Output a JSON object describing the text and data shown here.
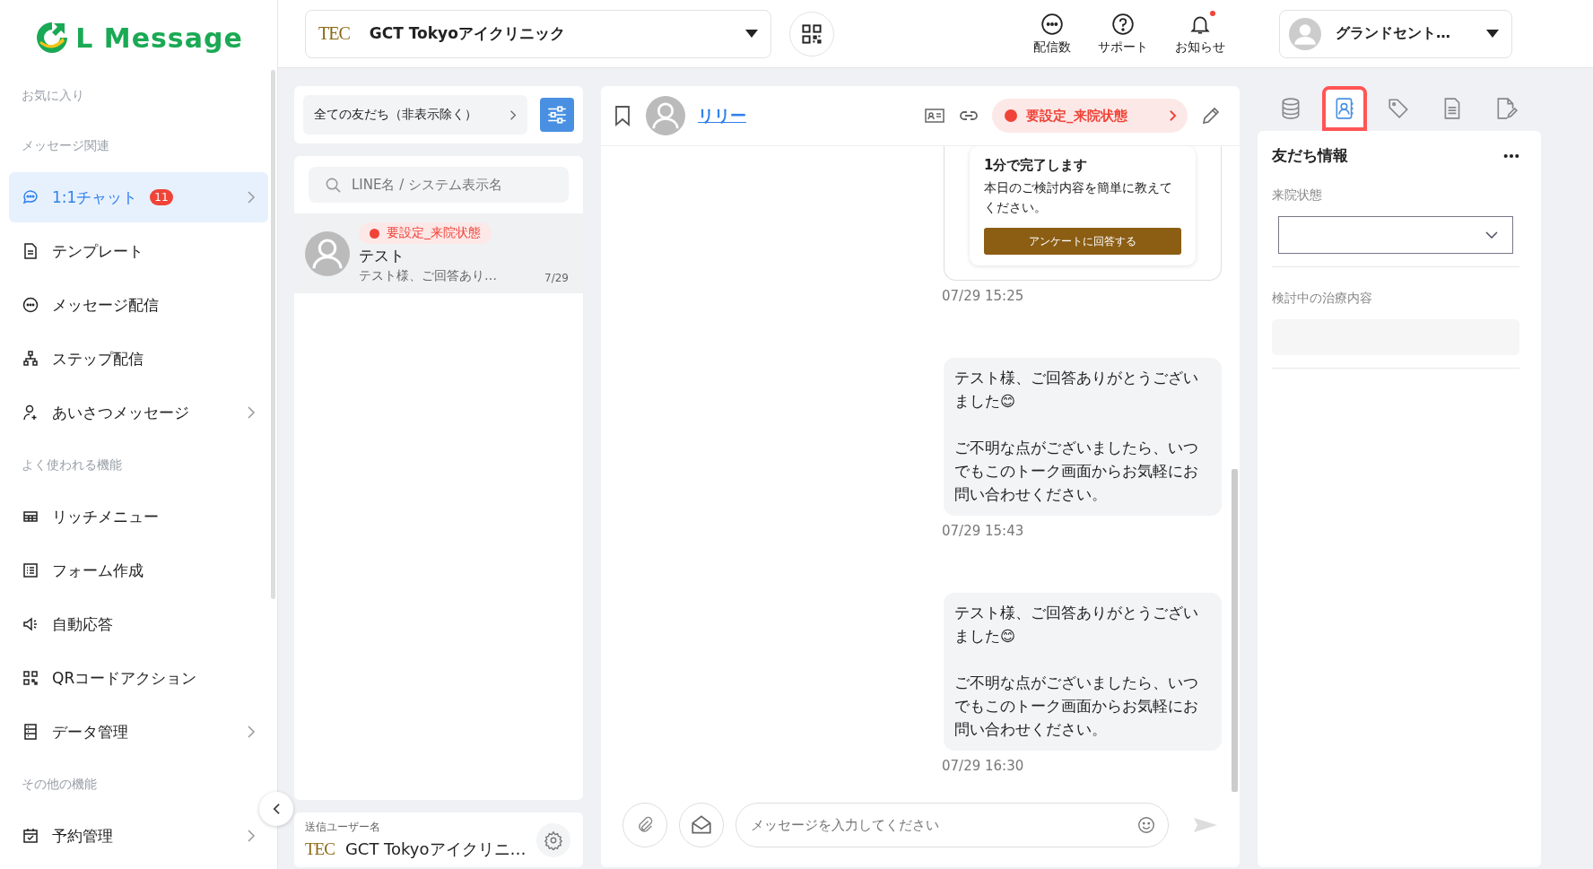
{
  "logo": {
    "text": "L Message"
  },
  "sidebar": {
    "sections": [
      {
        "label": "お気に入り"
      },
      {
        "label": "メッセージ関連",
        "items": [
          {
            "label": "1:1チャット",
            "badge": "11",
            "has_submenu": true,
            "selected": true
          },
          {
            "label": "テンプレート",
            "has_submenu": false,
            "selected": false
          },
          {
            "label": "メッセージ配信",
            "has_submenu": false,
            "selected": false
          },
          {
            "label": "ステップ配信",
            "has_submenu": false,
            "selected": false
          },
          {
            "label": "あいさつメッセージ",
            "has_submenu": true,
            "selected": false
          }
        ]
      },
      {
        "label": "よく使われる機能",
        "items": [
          {
            "label": "リッチメニュー",
            "has_submenu": false,
            "selected": false
          },
          {
            "label": "フォーム作成",
            "has_submenu": false,
            "selected": false
          },
          {
            "label": "自動応答",
            "has_submenu": false,
            "selected": false
          },
          {
            "label": "QRコードアクション",
            "has_submenu": false,
            "selected": false
          },
          {
            "label": "データ管理",
            "has_submenu": true,
            "selected": false
          }
        ]
      },
      {
        "label": "その他の機能",
        "items": [
          {
            "label": "予約管理",
            "has_submenu": true,
            "selected": false
          }
        ]
      }
    ]
  },
  "account": {
    "logo": "TEC",
    "name": "GCT Tokyoアイクリニック"
  },
  "header_actions": [
    {
      "label": "配信数",
      "unread": false
    },
    {
      "label": "サポート",
      "unread": false
    },
    {
      "label": "お知らせ",
      "unread": true
    }
  ],
  "user": {
    "name": "グランドセント…"
  },
  "friend_list": {
    "filter": "全ての友だち（非表示除く）",
    "search_placeholder": "LINE名 / システム表示名",
    "friends": [
      {
        "tag": "要設定_来院状態",
        "name": "テスト",
        "preview": "テスト様、ご回答あり…",
        "date": "7/29",
        "selected": true
      }
    ],
    "sender": {
      "label": "送信ユーザー名",
      "logo": "TEC",
      "name": "GCT Tokyoアイクリニ…"
    }
  },
  "chat": {
    "name": "リリー",
    "status": "要設定_来院状態",
    "messages": [
      {
        "kind": "card",
        "title": "1分で完了します",
        "body": "本日のご検討内容を簡単に教えてください。",
        "button": "アンケートに回答する",
        "time": "07/29 15:25"
      },
      {
        "kind": "text",
        "text": "テスト様、ご回答ありがとうございました😊\n\nご不明な点がございましたら、いつでもこのトーク画面からお気軽にお問い合わせください。",
        "time": "07/29 15:43"
      },
      {
        "kind": "text",
        "text": "テスト様、ご回答ありがとうございました😊\n\nご不明な点がございましたら、いつでもこのトーク画面からお気軽にお問い合わせください。",
        "time": "07/29 16:30"
      }
    ],
    "input_placeholder": "メッセージを入力してください"
  },
  "info_panel": {
    "tabs": [
      {
        "selected": false,
        "highlighted": false
      },
      {
        "selected": true,
        "highlighted": true
      },
      {
        "selected": false,
        "highlighted": false
      },
      {
        "selected": false,
        "highlighted": false
      },
      {
        "selected": false,
        "highlighted": false
      }
    ],
    "title": "友だち情報",
    "fields": [
      {
        "kind": "select",
        "label": "来院状態"
      },
      {
        "kind": "text",
        "label": "検討中の治療内容"
      }
    ]
  }
}
